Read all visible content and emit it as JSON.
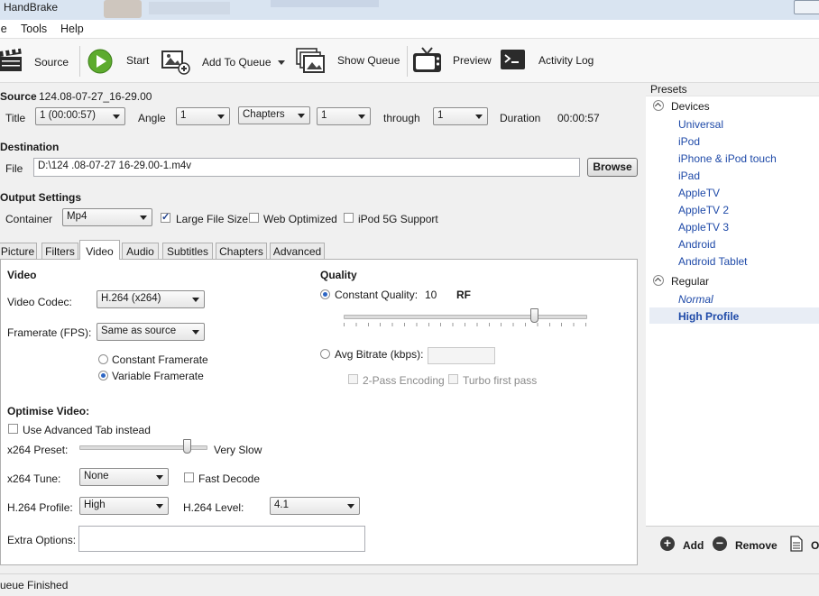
{
  "window": {
    "title": "HandBrake"
  },
  "menu": [
    "le",
    "Tools",
    "Help"
  ],
  "toolbar": {
    "source": "Source",
    "start": "Start",
    "add_to_queue": "Add To Queue",
    "show_queue": "Show Queue",
    "preview": "Preview",
    "activity_log": "Activity Log"
  },
  "source": {
    "label": "Source",
    "value": "124.08-07-27_16-29.00",
    "title_label": "Title",
    "title_value": "1 (00:00:57)",
    "angle_label": "Angle",
    "angle_value": "1",
    "range_type": "Chapters",
    "range_from": "1",
    "through_label": "through",
    "range_to": "1",
    "duration_label": "Duration",
    "duration_value": "00:00:57"
  },
  "destination": {
    "label": "Destination",
    "file_label": "File",
    "file_value": "D:\\124 .08-07-27 16-29.00-1.m4v",
    "browse": "Browse"
  },
  "output": {
    "label": "Output Settings",
    "container_label": "Container",
    "container_value": "Mp4",
    "large_file": "Large File Size",
    "web_optimized": "Web Optimized",
    "ipod": "iPod 5G Support"
  },
  "tabs": [
    "Picture",
    "Filters",
    "Video",
    "Audio",
    "Subtitles",
    "Chapters",
    "Advanced"
  ],
  "video": {
    "heading": "Video",
    "codec_label": "Video Codec:",
    "codec_value": "H.264 (x264)",
    "fps_label": "Framerate (FPS):",
    "fps_value": "Same as source",
    "constant_fr": "Constant Framerate",
    "variable_fr": "Variable Framerate"
  },
  "quality": {
    "heading": "Quality",
    "cq_label": "Constant Quality:",
    "cq_value": "10",
    "cq_unit": "RF",
    "cq_slider_fraction": 0.8,
    "avg_label": "Avg Bitrate (kbps):",
    "two_pass": "2-Pass Encoding",
    "turbo": "Turbo first pass"
  },
  "optimise": {
    "heading": "Optimise Video:",
    "advanced_tab": "Use Advanced Tab instead",
    "preset_label": "x264 Preset:",
    "preset_value": "Very Slow",
    "preset_slider_fraction": 0.85,
    "tune_label": "x264 Tune:",
    "tune_value": "None",
    "fast_decode": "Fast Decode",
    "profile_label": "H.264 Profile:",
    "profile_value": "High",
    "level_label": "H.264 Level:",
    "level_value": "4.1",
    "extra_label": "Extra Options:"
  },
  "presets": {
    "heading": "Presets",
    "devices_label": "Devices",
    "devices": [
      "Universal",
      "iPod",
      "iPhone & iPod touch",
      "iPad",
      "AppleTV",
      "AppleTV 2",
      "AppleTV 3",
      "Android",
      "Android Tablet"
    ],
    "regular_label": "Regular",
    "regular": [
      "Normal",
      "High Profile"
    ],
    "add": "Add",
    "remove": "Remove",
    "options": "O"
  },
  "status": "ueue Finished",
  "colors": {
    "link": "#1f4aa8",
    "selected_bg": "#e8edf5"
  }
}
